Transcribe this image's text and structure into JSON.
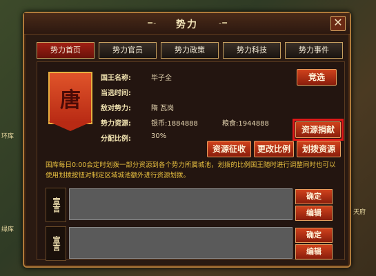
{
  "background": {
    "tile_labels": [
      "环库",
      "绿库",
      "天府"
    ]
  },
  "window": {
    "title": "势力",
    "title_deco_left": "=-",
    "title_deco_right": "-=",
    "close_glyph": "✕"
  },
  "tabs": [
    {
      "label": "势力首页",
      "active": true
    },
    {
      "label": "势力官员",
      "active": false
    },
    {
      "label": "势力政策",
      "active": false
    },
    {
      "label": "势力科技",
      "active": false
    },
    {
      "label": "势力事件",
      "active": false
    }
  ],
  "faction": {
    "banner_char": "唐",
    "king_label": "国王名称:",
    "king_value": "毕子全",
    "elect_time_label": "当选时间:",
    "elect_time_value": "",
    "enemy_label": "敌对势力:",
    "enemy_value": "隋  瓦岗",
    "resources_label": "势力资源:",
    "silver_value": "银币:1884888",
    "grain_value": "粮食:1944888",
    "ratio_label": "分配比例:",
    "ratio_value": "30%"
  },
  "buttons": {
    "elect": "竞选",
    "donate": "资源捐献",
    "collect": "资源征收",
    "change_ratio": "更改比例",
    "allocate": "划拨资源"
  },
  "notice": "国库每日0:00会定时划拨一部分资源到各个势力所属城池，划拨的比例国王随时进行调整同时也可以使用划拨按钮对制定区域城池额外进行资源划拨。",
  "announcements": [
    {
      "label": "宣言",
      "confirm": "确定",
      "edit": "编辑",
      "text": ""
    },
    {
      "label": "宣言",
      "confirm": "确定",
      "edit": "编辑",
      "text": ""
    }
  ],
  "colors": {
    "accent_red": "#c0301a",
    "highlight_border": "#e01818",
    "notice_text": "#e8c040"
  }
}
